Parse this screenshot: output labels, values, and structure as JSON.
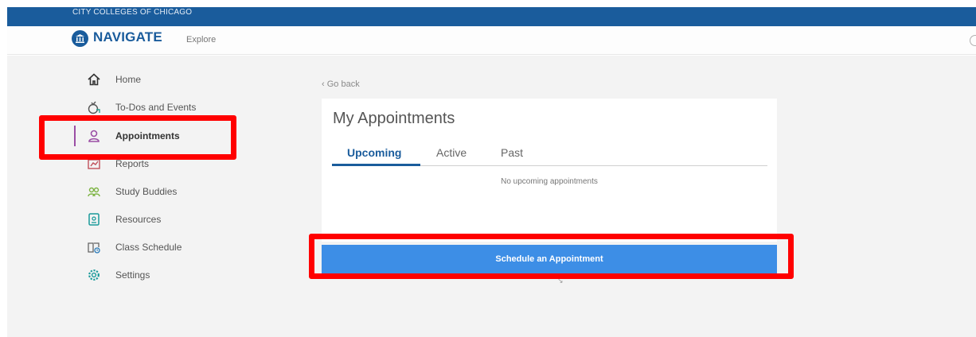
{
  "topbar": {
    "college_name": "CITY COLLEGES OF CHICAGO"
  },
  "header": {
    "brand": "NAVIGATE",
    "explore_label": "Explore"
  },
  "sidebar": {
    "items": [
      {
        "label": "Home",
        "icon": "home-icon"
      },
      {
        "label": "To-Dos and Events",
        "icon": "todo-icon"
      },
      {
        "label": "Appointments",
        "icon": "person-icon",
        "active": true
      },
      {
        "label": "Reports",
        "icon": "reports-icon"
      },
      {
        "label": "Study Buddies",
        "icon": "study-buddies-icon"
      },
      {
        "label": "Resources",
        "icon": "resources-icon"
      },
      {
        "label": "Class Schedule",
        "icon": "class-schedule-icon"
      },
      {
        "label": "Settings",
        "icon": "gear-icon"
      }
    ]
  },
  "main": {
    "back_label": "Go back",
    "card_title": "My Appointments",
    "tabs": [
      {
        "label": "Upcoming",
        "selected": true
      },
      {
        "label": "Active"
      },
      {
        "label": "Past"
      }
    ],
    "empty_message": "No upcoming appointments",
    "schedule_button": "Schedule an Appointment"
  },
  "colors": {
    "brand_blue": "#1a5c9c",
    "button_blue": "#3d8ee6",
    "active_purple": "#9b4ea5",
    "highlight_red": "#ff0000"
  }
}
